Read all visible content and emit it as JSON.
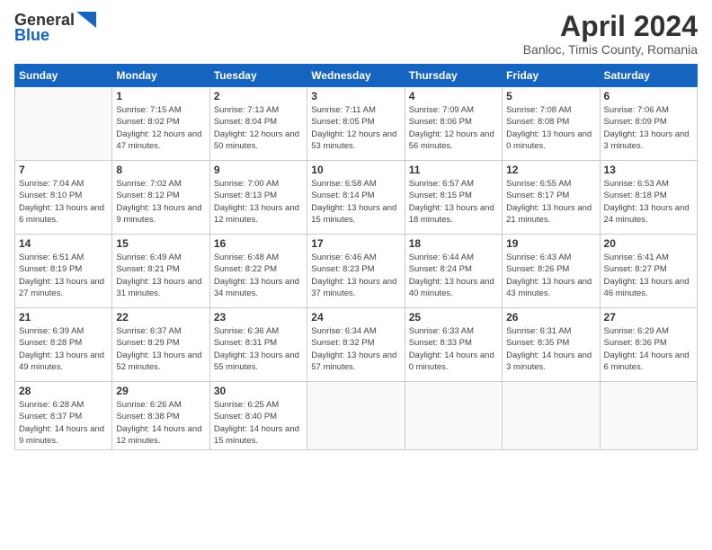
{
  "header": {
    "logo_general": "General",
    "logo_blue": "Blue",
    "title": "April 2024",
    "subtitle": "Banloc, Timis County, Romania"
  },
  "weekdays": [
    "Sunday",
    "Monday",
    "Tuesday",
    "Wednesday",
    "Thursday",
    "Friday",
    "Saturday"
  ],
  "weeks": [
    [
      {
        "day": "",
        "sunrise": "",
        "sunset": "",
        "daylight": ""
      },
      {
        "day": "1",
        "sunrise": "Sunrise: 7:15 AM",
        "sunset": "Sunset: 8:02 PM",
        "daylight": "Daylight: 12 hours and 47 minutes."
      },
      {
        "day": "2",
        "sunrise": "Sunrise: 7:13 AM",
        "sunset": "Sunset: 8:04 PM",
        "daylight": "Daylight: 12 hours and 50 minutes."
      },
      {
        "day": "3",
        "sunrise": "Sunrise: 7:11 AM",
        "sunset": "Sunset: 8:05 PM",
        "daylight": "Daylight: 12 hours and 53 minutes."
      },
      {
        "day": "4",
        "sunrise": "Sunrise: 7:09 AM",
        "sunset": "Sunset: 8:06 PM",
        "daylight": "Daylight: 12 hours and 56 minutes."
      },
      {
        "day": "5",
        "sunrise": "Sunrise: 7:08 AM",
        "sunset": "Sunset: 8:08 PM",
        "daylight": "Daylight: 13 hours and 0 minutes."
      },
      {
        "day": "6",
        "sunrise": "Sunrise: 7:06 AM",
        "sunset": "Sunset: 8:09 PM",
        "daylight": "Daylight: 13 hours and 3 minutes."
      }
    ],
    [
      {
        "day": "7",
        "sunrise": "Sunrise: 7:04 AM",
        "sunset": "Sunset: 8:10 PM",
        "daylight": "Daylight: 13 hours and 6 minutes."
      },
      {
        "day": "8",
        "sunrise": "Sunrise: 7:02 AM",
        "sunset": "Sunset: 8:12 PM",
        "daylight": "Daylight: 13 hours and 9 minutes."
      },
      {
        "day": "9",
        "sunrise": "Sunrise: 7:00 AM",
        "sunset": "Sunset: 8:13 PM",
        "daylight": "Daylight: 13 hours and 12 minutes."
      },
      {
        "day": "10",
        "sunrise": "Sunrise: 6:58 AM",
        "sunset": "Sunset: 8:14 PM",
        "daylight": "Daylight: 13 hours and 15 minutes."
      },
      {
        "day": "11",
        "sunrise": "Sunrise: 6:57 AM",
        "sunset": "Sunset: 8:15 PM",
        "daylight": "Daylight: 13 hours and 18 minutes."
      },
      {
        "day": "12",
        "sunrise": "Sunrise: 6:55 AM",
        "sunset": "Sunset: 8:17 PM",
        "daylight": "Daylight: 13 hours and 21 minutes."
      },
      {
        "day": "13",
        "sunrise": "Sunrise: 6:53 AM",
        "sunset": "Sunset: 8:18 PM",
        "daylight": "Daylight: 13 hours and 24 minutes."
      }
    ],
    [
      {
        "day": "14",
        "sunrise": "Sunrise: 6:51 AM",
        "sunset": "Sunset: 8:19 PM",
        "daylight": "Daylight: 13 hours and 27 minutes."
      },
      {
        "day": "15",
        "sunrise": "Sunrise: 6:49 AM",
        "sunset": "Sunset: 8:21 PM",
        "daylight": "Daylight: 13 hours and 31 minutes."
      },
      {
        "day": "16",
        "sunrise": "Sunrise: 6:48 AM",
        "sunset": "Sunset: 8:22 PM",
        "daylight": "Daylight: 13 hours and 34 minutes."
      },
      {
        "day": "17",
        "sunrise": "Sunrise: 6:46 AM",
        "sunset": "Sunset: 8:23 PM",
        "daylight": "Daylight: 13 hours and 37 minutes."
      },
      {
        "day": "18",
        "sunrise": "Sunrise: 6:44 AM",
        "sunset": "Sunset: 8:24 PM",
        "daylight": "Daylight: 13 hours and 40 minutes."
      },
      {
        "day": "19",
        "sunrise": "Sunrise: 6:43 AM",
        "sunset": "Sunset: 8:26 PM",
        "daylight": "Daylight: 13 hours and 43 minutes."
      },
      {
        "day": "20",
        "sunrise": "Sunrise: 6:41 AM",
        "sunset": "Sunset: 8:27 PM",
        "daylight": "Daylight: 13 hours and 46 minutes."
      }
    ],
    [
      {
        "day": "21",
        "sunrise": "Sunrise: 6:39 AM",
        "sunset": "Sunset: 8:28 PM",
        "daylight": "Daylight: 13 hours and 49 minutes."
      },
      {
        "day": "22",
        "sunrise": "Sunrise: 6:37 AM",
        "sunset": "Sunset: 8:29 PM",
        "daylight": "Daylight: 13 hours and 52 minutes."
      },
      {
        "day": "23",
        "sunrise": "Sunrise: 6:36 AM",
        "sunset": "Sunset: 8:31 PM",
        "daylight": "Daylight: 13 hours and 55 minutes."
      },
      {
        "day": "24",
        "sunrise": "Sunrise: 6:34 AM",
        "sunset": "Sunset: 8:32 PM",
        "daylight": "Daylight: 13 hours and 57 minutes."
      },
      {
        "day": "25",
        "sunrise": "Sunrise: 6:33 AM",
        "sunset": "Sunset: 8:33 PM",
        "daylight": "Daylight: 14 hours and 0 minutes."
      },
      {
        "day": "26",
        "sunrise": "Sunrise: 6:31 AM",
        "sunset": "Sunset: 8:35 PM",
        "daylight": "Daylight: 14 hours and 3 minutes."
      },
      {
        "day": "27",
        "sunrise": "Sunrise: 6:29 AM",
        "sunset": "Sunset: 8:36 PM",
        "daylight": "Daylight: 14 hours and 6 minutes."
      }
    ],
    [
      {
        "day": "28",
        "sunrise": "Sunrise: 6:28 AM",
        "sunset": "Sunset: 8:37 PM",
        "daylight": "Daylight: 14 hours and 9 minutes."
      },
      {
        "day": "29",
        "sunrise": "Sunrise: 6:26 AM",
        "sunset": "Sunset: 8:38 PM",
        "daylight": "Daylight: 14 hours and 12 minutes."
      },
      {
        "day": "30",
        "sunrise": "Sunrise: 6:25 AM",
        "sunset": "Sunset: 8:40 PM",
        "daylight": "Daylight: 14 hours and 15 minutes."
      },
      {
        "day": "",
        "sunrise": "",
        "sunset": "",
        "daylight": ""
      },
      {
        "day": "",
        "sunrise": "",
        "sunset": "",
        "daylight": ""
      },
      {
        "day": "",
        "sunrise": "",
        "sunset": "",
        "daylight": ""
      },
      {
        "day": "",
        "sunrise": "",
        "sunset": "",
        "daylight": ""
      }
    ]
  ]
}
